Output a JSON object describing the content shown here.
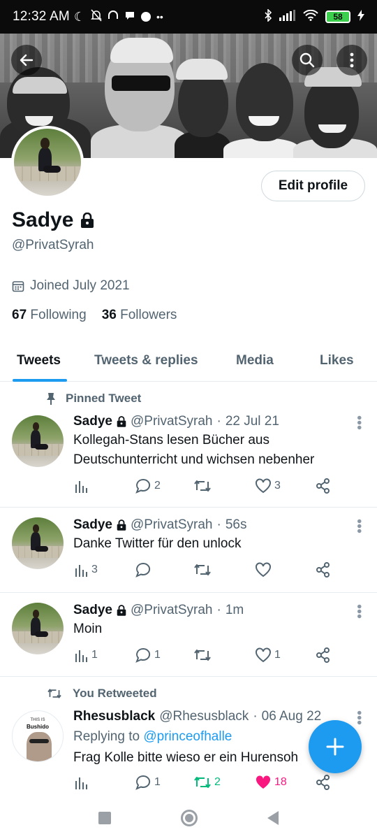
{
  "status_bar": {
    "time": "12:32 AM",
    "battery": "58",
    "icons_left": [
      "moon-icon",
      "bell-off-icon",
      "headphones-icon",
      "chat-bubble-icon",
      "dot-icon",
      "more-dots-icon"
    ],
    "icons_right": [
      "bluetooth-icon",
      "signal-icon",
      "wifi-icon",
      "battery-icon",
      "charging-icon"
    ]
  },
  "header": {
    "back_icon": "arrow-left-icon",
    "search_icon": "search-icon",
    "more_icon": "more-vertical-icon"
  },
  "profile": {
    "name": "Sadye",
    "handle": "@PrivatSyrah",
    "joined": "Joined July 2021",
    "following_count": "67",
    "following_label": "Following",
    "followers_count": "36",
    "followers_label": "Followers",
    "edit_button": "Edit profile"
  },
  "tabs": [
    "Tweets",
    "Tweets & replies",
    "Media",
    "Likes"
  ],
  "tweets": [
    {
      "label": "Pinned Tweet",
      "name": "Sadye",
      "handle": "@PrivatSyrah",
      "time": "22 Jul 21",
      "text_lines": [
        "Kollegah-Stans lesen Bücher aus",
        "Deutschunterricht und wichsen nebenher"
      ],
      "views": "",
      "replies": "2",
      "retweets": "",
      "likes": "3"
    },
    {
      "name": "Sadye",
      "handle": "@PrivatSyrah",
      "time": "56s",
      "text_lines": [
        "Danke Twitter für den unlock"
      ],
      "views": "3",
      "replies": "",
      "retweets": "",
      "likes": ""
    },
    {
      "name": "Sadye",
      "handle": "@PrivatSyrah",
      "time": "1m",
      "text_lines": [
        "Moin"
      ],
      "views": "1",
      "replies": "1",
      "retweets": "",
      "likes": "1"
    },
    {
      "label": "You Retweeted",
      "name": "Rhesusblack",
      "handle": "@Rhesusblack",
      "time": "06 Aug 22",
      "reply_prefix": "Replying to",
      "reply_to": "@princeofhalle",
      "avatar_text_small": "THIS IS",
      "avatar_text_big": "Bushido",
      "text_lines": [
        "Frag Kolle bitte wieso er ein Hurensoh"
      ],
      "views": "",
      "replies": "1",
      "retweets": "2",
      "likes": "18"
    }
  ],
  "colors": {
    "accent": "#1d9bf0",
    "like": "#f91880",
    "retweet": "#00ba7c",
    "muted": "#536471"
  }
}
